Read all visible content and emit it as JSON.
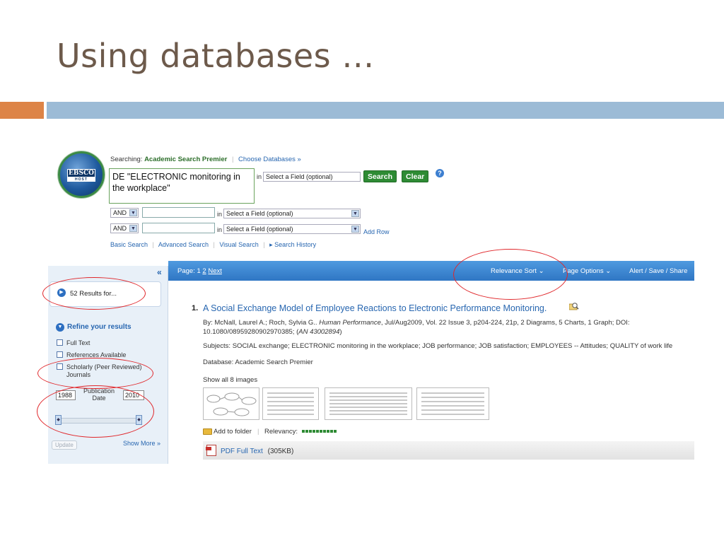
{
  "slide": {
    "title": "Using databases …"
  },
  "logo": {
    "text": "EBSCO",
    "subtext": "HOST"
  },
  "search": {
    "searching_label": "Searching:",
    "database": "Academic Search Premier",
    "choose_databases": "Choose Databases »",
    "query_line1": "DE \"ELECTRONIC monitoring in",
    "query_line2": "the workplace\"",
    "in_label": "in",
    "field_placeholder": "Select a Field (optional)",
    "search_button": "Search",
    "clear_button": "Clear",
    "help": "?",
    "rows": [
      {
        "operator": "AND",
        "value": "",
        "field": "Select a Field (optional)"
      },
      {
        "operator": "AND",
        "value": "",
        "field": "Select a Field (optional)"
      }
    ],
    "add_row": "Add Row"
  },
  "subnav": {
    "basic": "Basic Search",
    "advanced": "Advanced Search",
    "visual": "Visual Search",
    "history": "Search History"
  },
  "left_panel": {
    "collapse": "«",
    "results_for": "52 Results for...",
    "refine": "Refine your results",
    "filters": [
      {
        "label": "Full Text"
      },
      {
        "label": "References Available"
      },
      {
        "label": "Scholarly (Peer Reviewed)",
        "label2": "Journals"
      }
    ],
    "date_from": "1988",
    "date_to": "2010",
    "date_label1": "Publication",
    "date_label2": "Date",
    "update": "Update",
    "show_more": "Show More »"
  },
  "result_bar": {
    "page_label": "Page: 1",
    "page2": "2",
    "next": "Next",
    "relevance": "Relevance Sort ⌄",
    "page_options": "Page Options ⌄",
    "alert": "Alert / Save / Share"
  },
  "result": {
    "number": "1.",
    "title": "A Social Exchange Model of Employee Reactions to Electronic Performance Monitoring.",
    "by": "By: McNall, Laurel A.; Roch, Sylvia G..",
    "journal": "Human Performance",
    "details": ", Jul/Aug2009, Vol. 22 Issue 3, p204-224, 21p, 2 Diagrams, 5 Charts, 1 Graph; DOI:",
    "doi": "10.1080/08959280902970385; (",
    "an": "AN 43002894",
    "close": ")",
    "subjects": "Subjects: SOCIAL exchange; ELECTRONIC monitoring in the workplace; JOB performance; JOB satisfaction; EMPLOYEES -- Attitudes; QUALITY of work life",
    "database": "Database: Academic Search Premier",
    "show_images": "Show all 8 images",
    "add_folder": "Add to folder",
    "relevancy": "Relevancy:",
    "pdf_link": "PDF Full Text",
    "pdf_size": "(305KB)"
  },
  "colors": {
    "title": "#6d5a4b",
    "accent_orange": "#dd8447",
    "accent_blue": "#9cbbd6",
    "link": "#2766b0",
    "button_green": "#2e8b34",
    "annotation": "#e0262a"
  }
}
